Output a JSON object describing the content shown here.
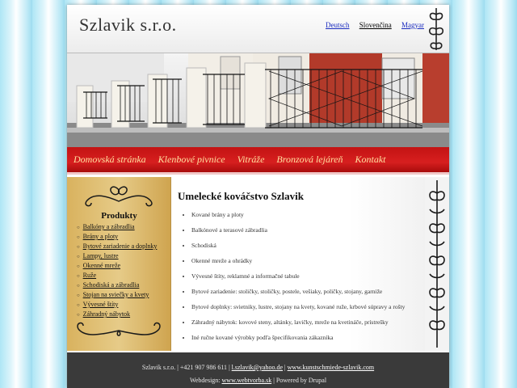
{
  "header": {
    "logo": "Szlavik s.r.o.",
    "languages": [
      "Deutsch",
      "Slovenčina",
      "Magyar"
    ]
  },
  "nav": {
    "items": [
      "Domovská stránka",
      "Klenbové pivnice",
      "Vitráže",
      "Bronzová lejáreň",
      "Kontakt"
    ]
  },
  "sidebar": {
    "title": "Produkty",
    "items": [
      "Balkóny a zábradlia",
      "Brány a ploty",
      "Bytové zariadenie a doplnky",
      "Lampy, lustre",
      "Okenné mreže",
      "Ruže",
      "Schodiská a zábradlia",
      "Stojan na sviečky a kvety",
      "Vývesné štíty",
      "Záhradný nábytok"
    ]
  },
  "content": {
    "title": "Umelecké kováčstvo Szlavik",
    "items": [
      "Kované brány a ploty",
      "Balkónové a terasové zábradlia",
      "Schodiská",
      "Okenné mreže a ohrádky",
      "Vývesné štíty, reklamné a informačné tabule",
      "Bytové zariadenie: stoličky, stoličky, postele, vešiaky, poličky, stojany, garniže",
      "Bytové doplnky: svietniky, lustre, stojany na kvety, kované ruže, krbové súpravy a rošty",
      "Záhradný nábytok: kovové steny, altánky, lavičky, mreže na kvetináče, prístrešky",
      "Iné ručne kované výrobky podľa špecifikovania zákazníka"
    ]
  },
  "footer": {
    "company": "Szlavik s.r.o.",
    "phone": "+421 907 986 611",
    "email": "l.szlavik@yahoo.de",
    "website": "www.kunstschmiede-szlavik.com",
    "webdesign_label": "Webdesign:",
    "webdesign_link": "www.webtvorba.sk",
    "powered": "Powered by Drupal",
    "separator": "|"
  },
  "colors": {
    "nav_red": "#c31313",
    "nav_text": "#ffe0a0",
    "sidebar_gold": "#d9b25e",
    "footer_bg": "#3a3a3a",
    "link_blue": "#1a2bbf"
  }
}
